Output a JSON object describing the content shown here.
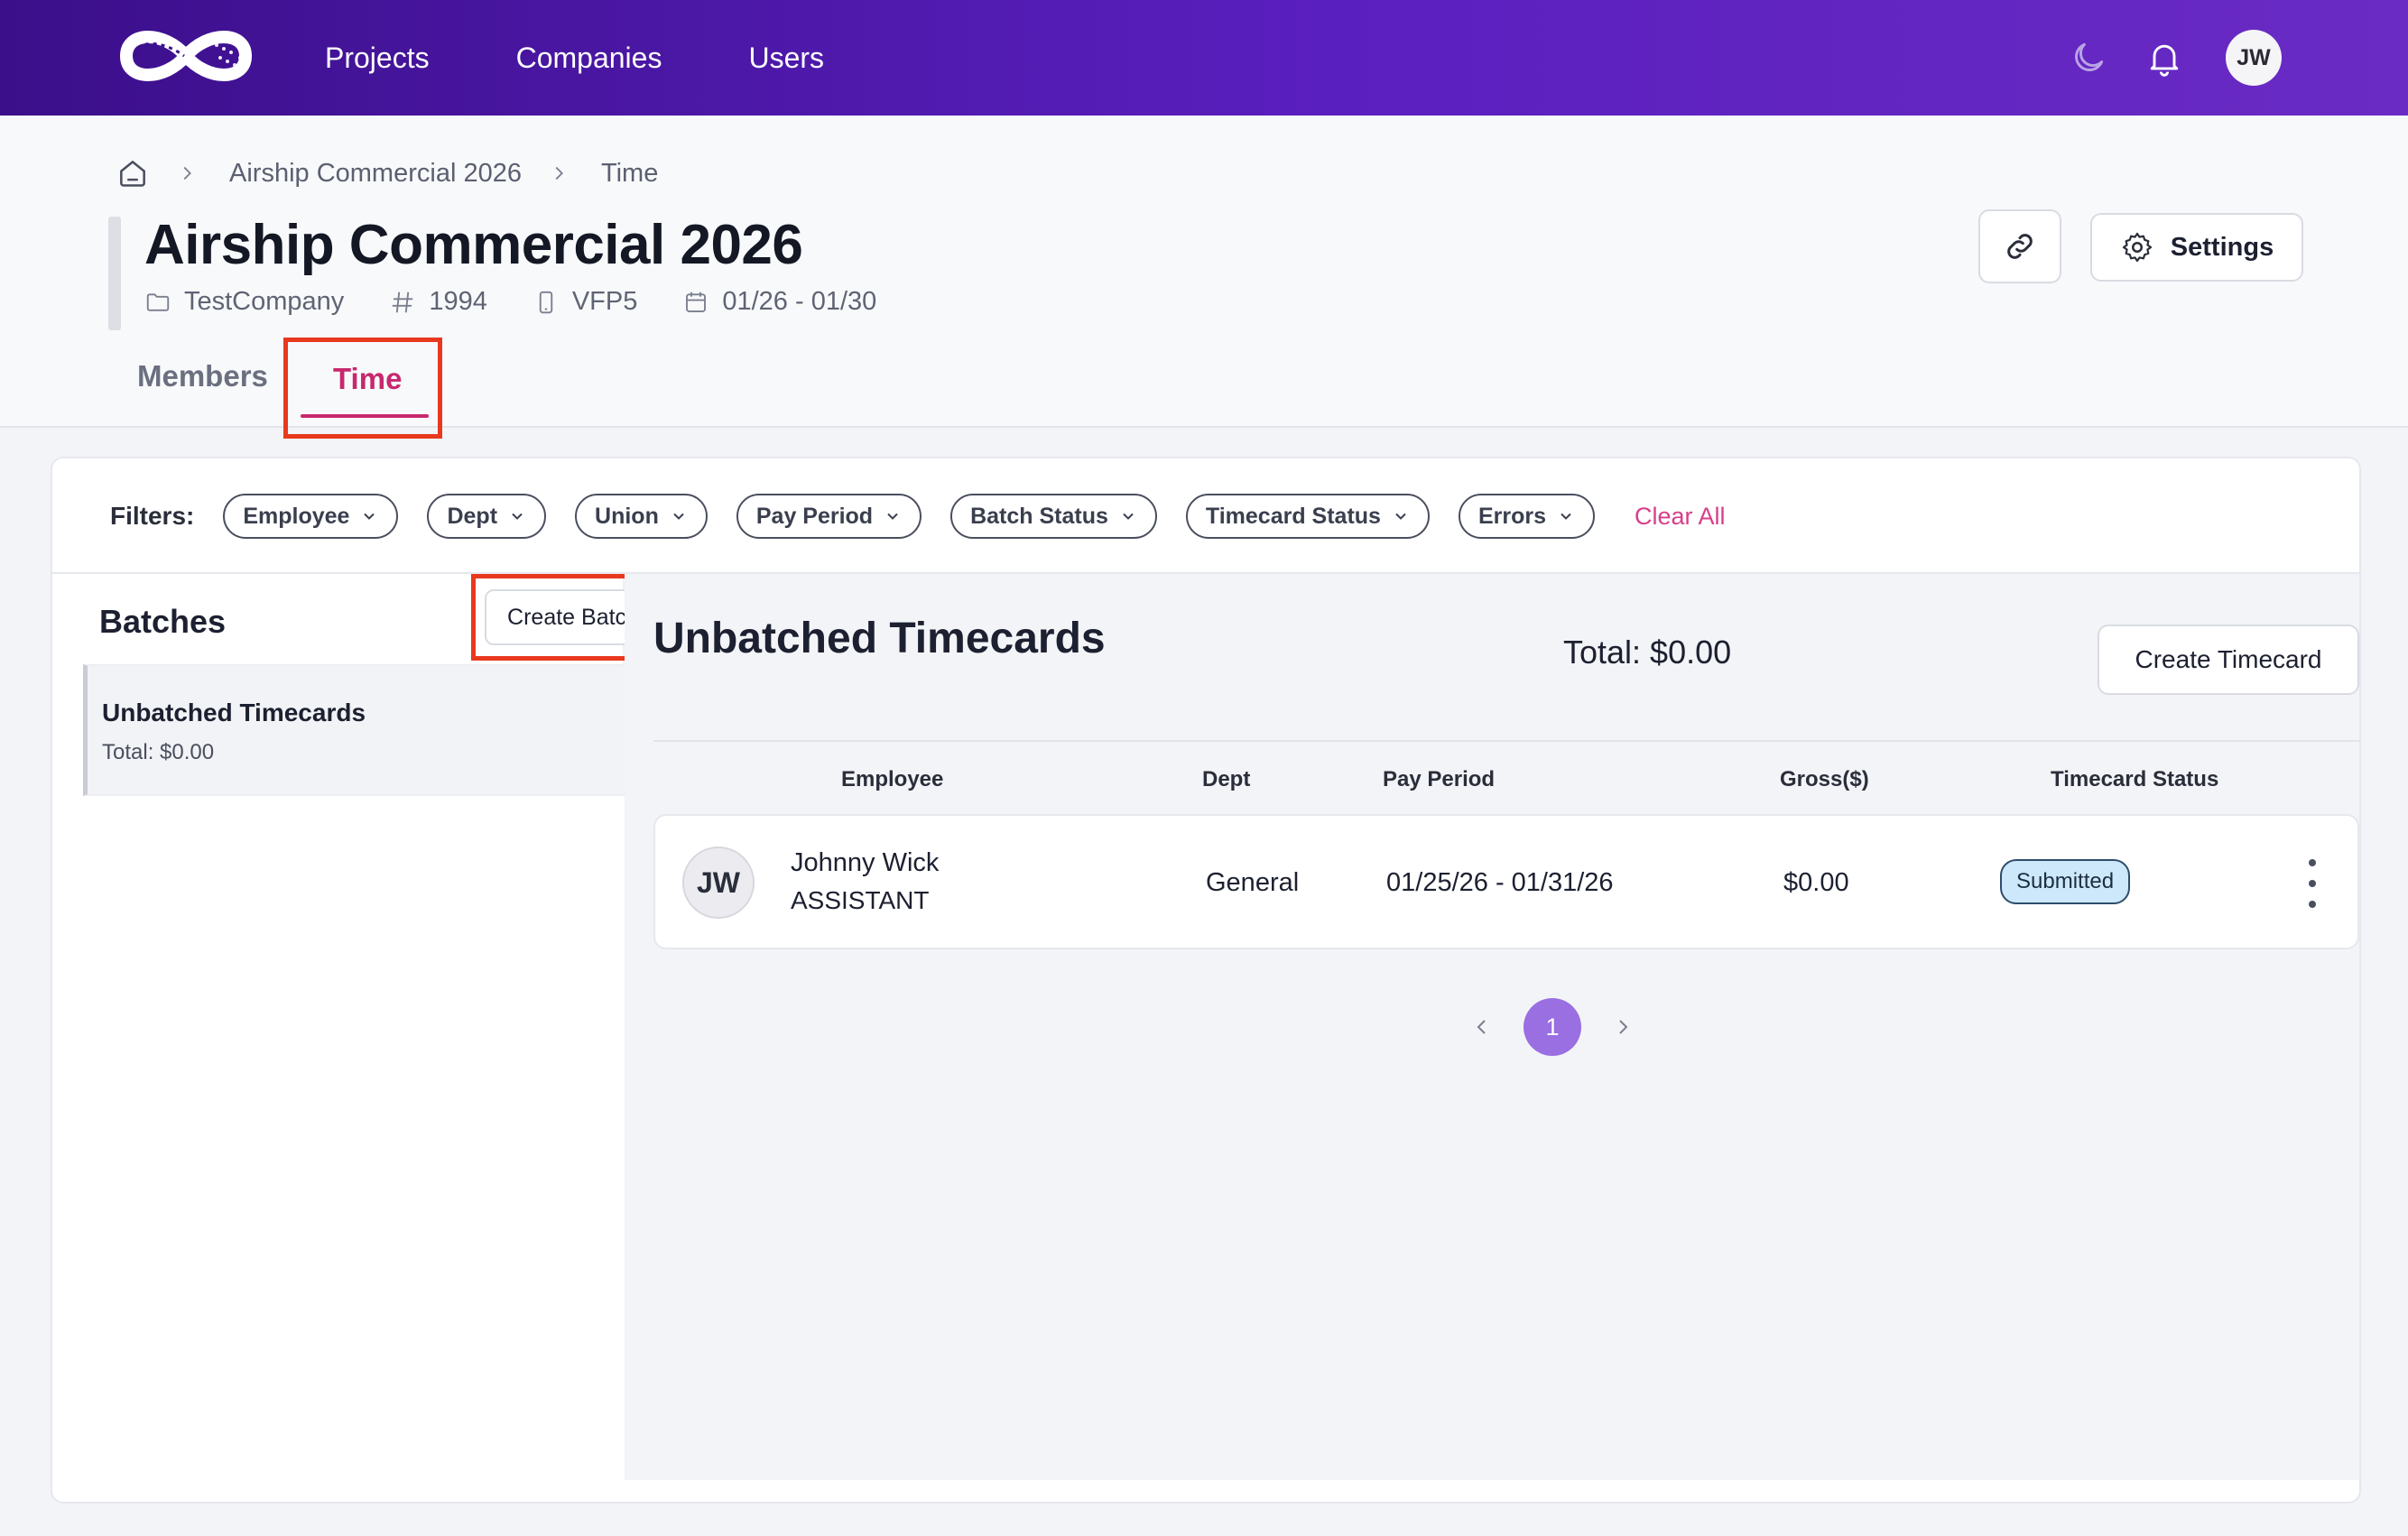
{
  "nav": {
    "links": [
      "Projects",
      "Companies",
      "Users"
    ],
    "avatar_initials": "JW",
    "icons": [
      "moon-icon",
      "bell-icon"
    ]
  },
  "breadcrumb": {
    "items": [
      "Airship Commercial 2026",
      "Time"
    ]
  },
  "project": {
    "title": "Airship Commercial 2026",
    "company": "TestCompany",
    "number": "1994",
    "code": "VFP5",
    "dates": "01/26 - 01/30"
  },
  "actions": {
    "settings_label": "Settings"
  },
  "tabs": [
    {
      "label": "Members",
      "active": false
    },
    {
      "label": "Time",
      "active": true
    }
  ],
  "filters": {
    "label": "Filters:",
    "chips": [
      "Employee",
      "Dept",
      "Union",
      "Pay Period",
      "Batch Status",
      "Timecard Status",
      "Errors"
    ],
    "clear_label": "Clear All"
  },
  "batches": {
    "title": "Batches",
    "create_label": "Create Batch",
    "items": [
      {
        "title": "Unbatched Timecards",
        "total": "Total:  $0.00"
      }
    ]
  },
  "timecards": {
    "title": "Unbatched Timecards",
    "total": "Total:  $0.00",
    "create_label": "Create Timecard",
    "columns": [
      "Employee",
      "Dept",
      "Pay Period",
      "Gross($)",
      "Timecard Status"
    ],
    "rows": [
      {
        "initials": "JW",
        "name": "Johnny Wick",
        "role": "ASSISTANT",
        "dept": "General",
        "pay_period": "01/25/26 - 01/31/26",
        "gross": "$0.00",
        "status": "Submitted"
      }
    ]
  },
  "pagination": {
    "current": "1"
  },
  "colors": {
    "nav_gradient_start": "#3b0f8a",
    "nav_gradient_end": "#6a2bc4",
    "accent_pink": "#c8286e",
    "highlight_red": "#e8391f",
    "status_blue": "#cde7fb",
    "page_purple": "#9a6fe2"
  }
}
